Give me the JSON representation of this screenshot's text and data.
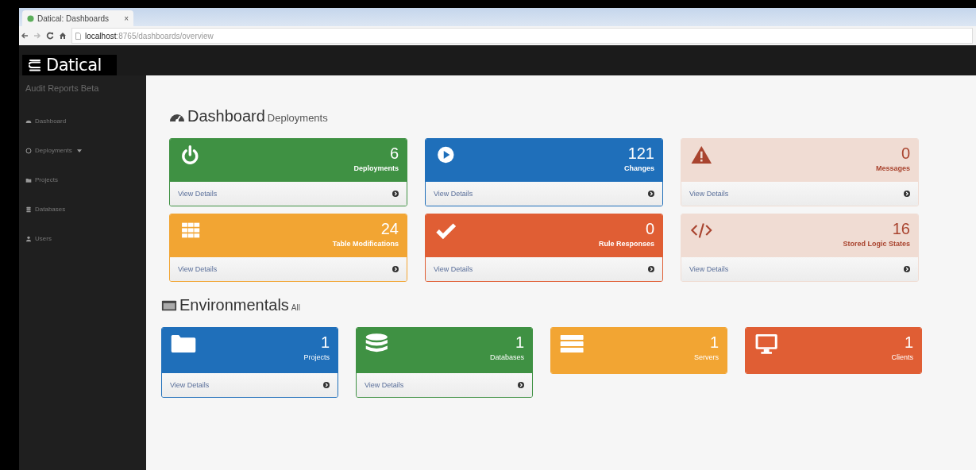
{
  "browser": {
    "tab_title": "Datical: Dashboards",
    "tab_close": "×",
    "url_host": "localhost",
    "url_path": ":8765/dashboards/overview"
  },
  "brand": {
    "name": "Datical"
  },
  "sidebar": {
    "title": "Audit Reports Beta",
    "items": [
      {
        "label": "Dashboard",
        "kind": "gauge",
        "dropdown": false
      },
      {
        "label": "Deployments",
        "kind": "circle",
        "dropdown": true
      },
      {
        "label": "Projects",
        "kind": "folder",
        "dropdown": false
      },
      {
        "label": "Databases",
        "kind": "database",
        "dropdown": false
      },
      {
        "label": "Users",
        "kind": "user",
        "dropdown": false
      }
    ]
  },
  "dashboard": {
    "title": "Dashboard",
    "subtitle": "Deployments",
    "cards": [
      {
        "kind": "power",
        "color": "#3f9143",
        "count": "6",
        "label": "Deployments",
        "footer": "View Details"
      },
      {
        "kind": "play",
        "color": "#1f6fba",
        "count": "121",
        "label": "Changes",
        "footer": "View Details"
      },
      {
        "kind": "warning",
        "color": "#f0dcd3",
        "count": "0",
        "label": "Messages",
        "footer": "View Details"
      },
      {
        "kind": "grid",
        "color": "#f2a533",
        "count": "24",
        "label": "Table Modifications",
        "footer": "View Details"
      },
      {
        "kind": "check",
        "color": "#e05e34",
        "count": "0",
        "label": "Rule Responses",
        "footer": "View Details"
      },
      {
        "kind": "code",
        "color": "#f0dcd3",
        "count": "16",
        "label": "Stored Logic States",
        "footer": "View Details"
      }
    ]
  },
  "environmentals": {
    "title": "Environmentals",
    "subtitle": "All",
    "cards": [
      {
        "kind": "folder",
        "color": "#1f6fba",
        "count": "1",
        "label": "Projects",
        "footer": "View Details"
      },
      {
        "kind": "database",
        "color": "#3f9143",
        "count": "1",
        "label": "Databases",
        "footer": "View Details"
      },
      {
        "kind": "servers",
        "color": "#f2a533",
        "count": "1",
        "label": "Servers"
      },
      {
        "kind": "monitor",
        "color": "#e05e34",
        "count": "1",
        "label": "Clients"
      }
    ]
  }
}
